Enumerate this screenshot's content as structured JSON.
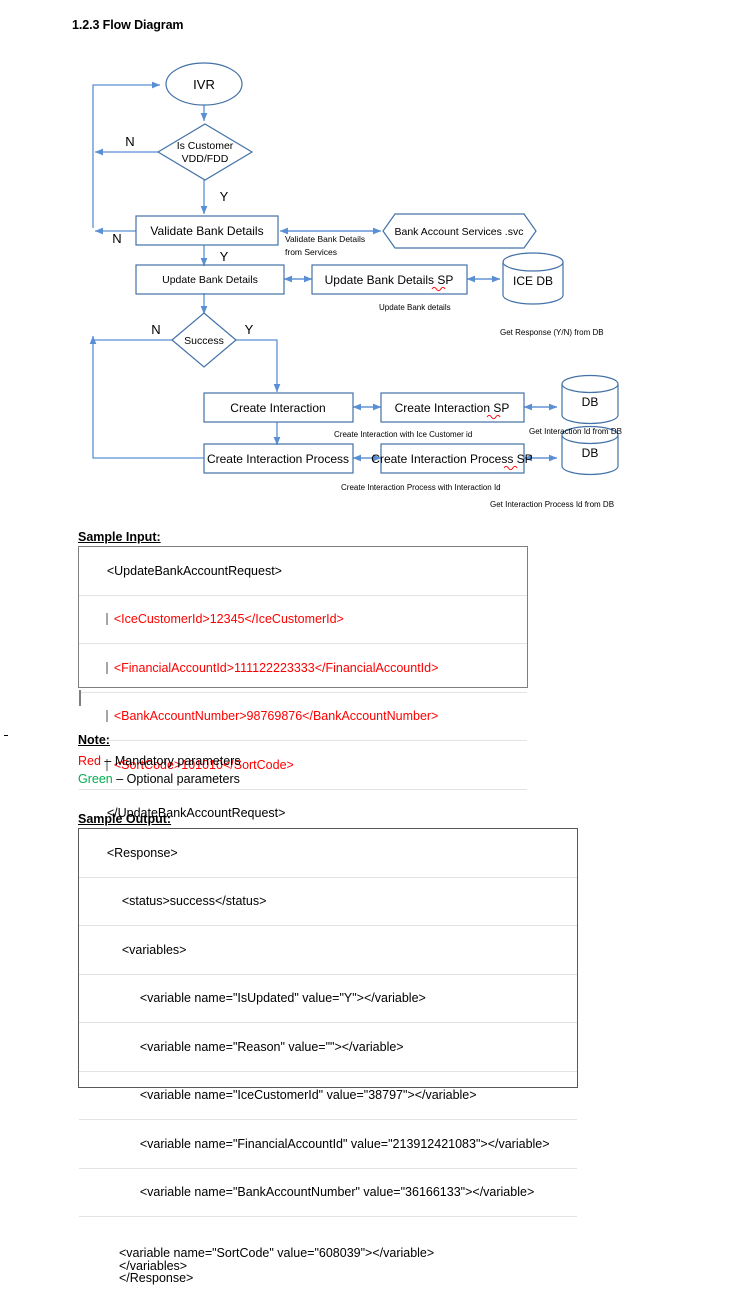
{
  "document": {
    "title": "1.2.3 Flow Diagram"
  },
  "flow": {
    "nodes": {
      "ivr": "IVR",
      "is_customer_line1": "Is Customer",
      "is_customer_line2": "VDD/FDD",
      "validate_bank_details": "Validate Bank Details",
      "bank_account_services": "Bank Account Services .svc",
      "update_bank_details": "Update Bank Details",
      "update_bank_details_sp": "Update Bank Details SP",
      "ice_db": "ICE DB",
      "success": "Success",
      "create_interaction": "Create Interaction",
      "create_interaction_sp": "Create Interaction SP",
      "db_1": "DB",
      "create_interaction_process": "Create Interaction Process",
      "create_interaction_process_sp": "Create Interaction Process SP",
      "db_2": "DB"
    },
    "edge_labels": {
      "n_from_is_customer": "N",
      "y_from_is_customer": "Y",
      "n_from_validate": "N",
      "y_from_validate": "Y",
      "n_from_success": "N",
      "y_from_success": "Y"
    },
    "captions": {
      "validate_from_services_line1": "Validate Bank Details",
      "validate_from_services_line2": "from Services",
      "update_bank_details": "Update Bank details",
      "get_response_from_db": "Get Response (Y/N) from DB",
      "create_interaction_with_ice": "Create Interaction with Ice Customer id",
      "get_interaction_id_from_db": "Get Interaction Id from DB",
      "create_interaction_process_with_id": "Create Interaction Process with Interaction Id",
      "get_interaction_process_id_from_db": "Get Interaction Process Id from DB"
    },
    "colors": {
      "shape_stroke": "#4472a8",
      "connector": "#5b8fd4",
      "spellcheck_underline": "#ff0000"
    }
  },
  "sample_input": {
    "label": "Sample Input:",
    "lines": [
      {
        "text": "<UpdateBankAccountRequest>",
        "color": "black",
        "indent": 0
      },
      {
        "text": "<IceCustomerId>12345</IceCustomerId>",
        "color": "red",
        "indent": 1
      },
      {
        "text": "<FinancialAccountId>111122223333</FinancialAccountId>",
        "color": "red",
        "indent": 1
      },
      {
        "text": "<BankAccountNumber>98769876</BankAccountNumber>",
        "color": "red",
        "indent": 1
      },
      {
        "text": "<SortCode>101010</SortCode>",
        "color": "red",
        "indent": 1
      },
      {
        "text": "</UpdateBankAccountRequest>",
        "color": "black",
        "indent": 0
      }
    ]
  },
  "note": {
    "label": "Note:",
    "lines": [
      {
        "swatch": "Red",
        "swatch_color": "#ff0000",
        "text": " – Mandatory parameters"
      },
      {
        "swatch": "Green",
        "swatch_color": "#00b050",
        "text": " – Optional parameters"
      }
    ]
  },
  "sample_output": {
    "label": "Sample Output:",
    "lines": [
      {
        "text": "<Response>",
        "indent": 0
      },
      {
        "text": "<status>success</status>",
        "indent": 1
      },
      {
        "text": "<variables>",
        "indent": 1
      },
      {
        "text": "<variable name=\"IsUpdated\" value=\"Y\"></variable>",
        "indent": 2
      },
      {
        "text": "<variable name=\"Reason\" value=\"\"></variable>",
        "indent": 2
      },
      {
        "text": "<variable name=\"IceCustomerId\" value=\"38797\"></variable>",
        "indent": 2
      },
      {
        "text": "<variable name=\"FinancialAccountId\" value=\"213912421083\"></variable>",
        "indent": 2
      },
      {
        "text": "<variable name=\"BankAccountNumber\" value=\"36166133\"></variable>",
        "indent": 2
      },
      {
        "text": "<variable name=\"SortCode\" value=\"608039\"></variable>\n</variables>\n</Response>",
        "indent": 2,
        "multiline": true
      }
    ]
  }
}
